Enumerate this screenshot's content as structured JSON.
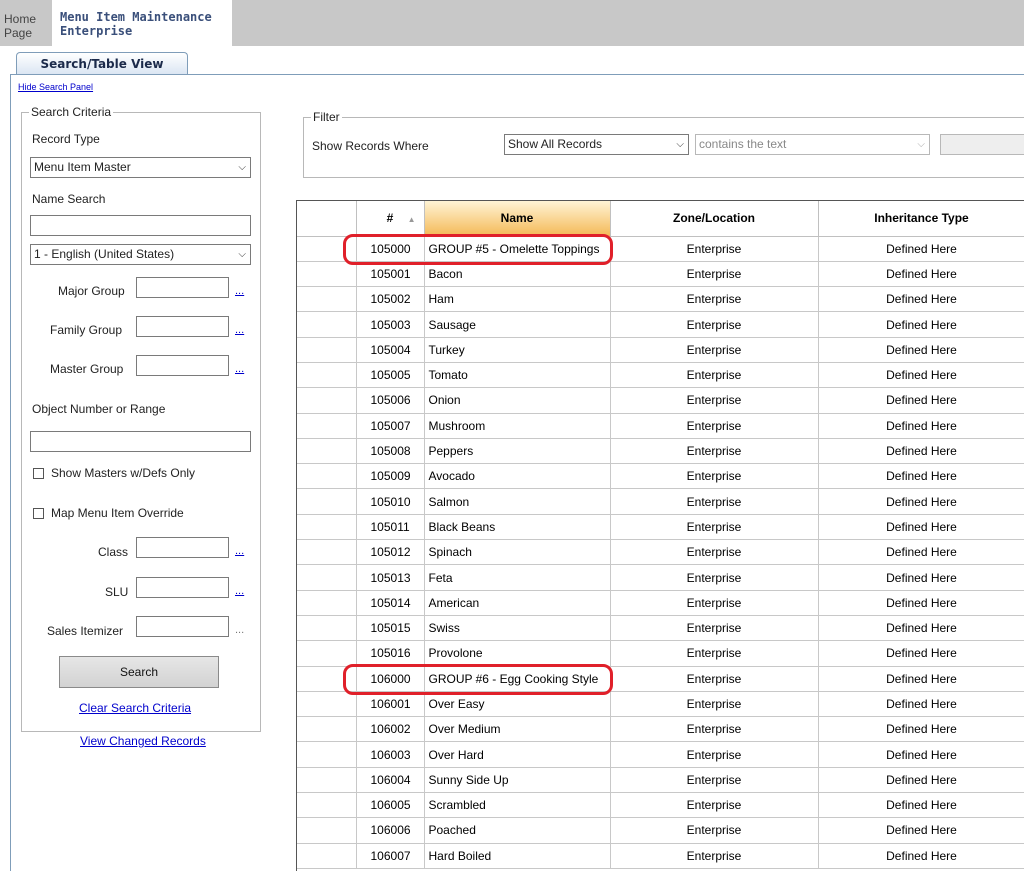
{
  "tabs": {
    "home": [
      "Home",
      "Page"
    ],
    "active": [
      "Menu Item Maintenance",
      "Enterprise"
    ],
    "view": "Search/Table View"
  },
  "search_panel": {
    "hide_link": "Hide Search Panel",
    "legend": "Search Criteria",
    "record_type_label": "Record Type",
    "record_type_value": "Menu Item Master",
    "name_search_label": "Name Search",
    "name_search_value": "",
    "language_value": "1 - English (United States)",
    "major_group_label": "Major Group",
    "family_group_label": "Family Group",
    "master_group_label": "Master Group",
    "object_number_label": "Object Number or Range",
    "show_masters_label": "Show Masters w/Defs Only",
    "map_override_label": "Map Menu Item Override",
    "class_label": "Class",
    "slu_label": "SLU",
    "sales_itemizer_label": "Sales Itemizer",
    "ellipsis": "...",
    "search_button": "Search",
    "clear_link": "Clear Search Criteria",
    "changed_link": "View Changed Records"
  },
  "filter": {
    "legend": "Filter",
    "show_records_label": "Show Records Where",
    "field_value": "Show All Records",
    "operator_placeholder": "contains the text"
  },
  "grid": {
    "columns": [
      "#",
      "Name",
      "Zone/Location",
      "Inheritance Type"
    ],
    "rows": [
      [
        "105000",
        "GROUP #5 - Omelette Toppings",
        "Enterprise",
        "Defined Here"
      ],
      [
        "105001",
        "Bacon",
        "Enterprise",
        "Defined Here"
      ],
      [
        "105002",
        "Ham",
        "Enterprise",
        "Defined Here"
      ],
      [
        "105003",
        "Sausage",
        "Enterprise",
        "Defined Here"
      ],
      [
        "105004",
        "Turkey",
        "Enterprise",
        "Defined Here"
      ],
      [
        "105005",
        "Tomato",
        "Enterprise",
        "Defined Here"
      ],
      [
        "105006",
        "Onion",
        "Enterprise",
        "Defined Here"
      ],
      [
        "105007",
        "Mushroom",
        "Enterprise",
        "Defined Here"
      ],
      [
        "105008",
        "Peppers",
        "Enterprise",
        "Defined Here"
      ],
      [
        "105009",
        "Avocado",
        "Enterprise",
        "Defined Here"
      ],
      [
        "105010",
        "Salmon",
        "Enterprise",
        "Defined Here"
      ],
      [
        "105011",
        "Black Beans",
        "Enterprise",
        "Defined Here"
      ],
      [
        "105012",
        "Spinach",
        "Enterprise",
        "Defined Here"
      ],
      [
        "105013",
        "Feta",
        "Enterprise",
        "Defined Here"
      ],
      [
        "105014",
        "American",
        "Enterprise",
        "Defined Here"
      ],
      [
        "105015",
        "Swiss",
        "Enterprise",
        "Defined Here"
      ],
      [
        "105016",
        "Provolone",
        "Enterprise",
        "Defined Here"
      ],
      [
        "106000",
        "GROUP #6 - Egg Cooking Style",
        "Enterprise",
        "Defined Here"
      ],
      [
        "106001",
        "Over Easy",
        "Enterprise",
        "Defined Here"
      ],
      [
        "106002",
        "Over Medium",
        "Enterprise",
        "Defined Here"
      ],
      [
        "106003",
        "Over Hard",
        "Enterprise",
        "Defined Here"
      ],
      [
        "106004",
        "Sunny Side Up",
        "Enterprise",
        "Defined Here"
      ],
      [
        "106005",
        "Scrambled",
        "Enterprise",
        "Defined Here"
      ],
      [
        "106006",
        "Poached",
        "Enterprise",
        "Defined Here"
      ],
      [
        "106007",
        "Hard Boiled",
        "Enterprise",
        "Defined Here"
      ]
    ],
    "highlighted_rows": [
      0,
      17
    ],
    "highlight_color": "#e0202a"
  }
}
